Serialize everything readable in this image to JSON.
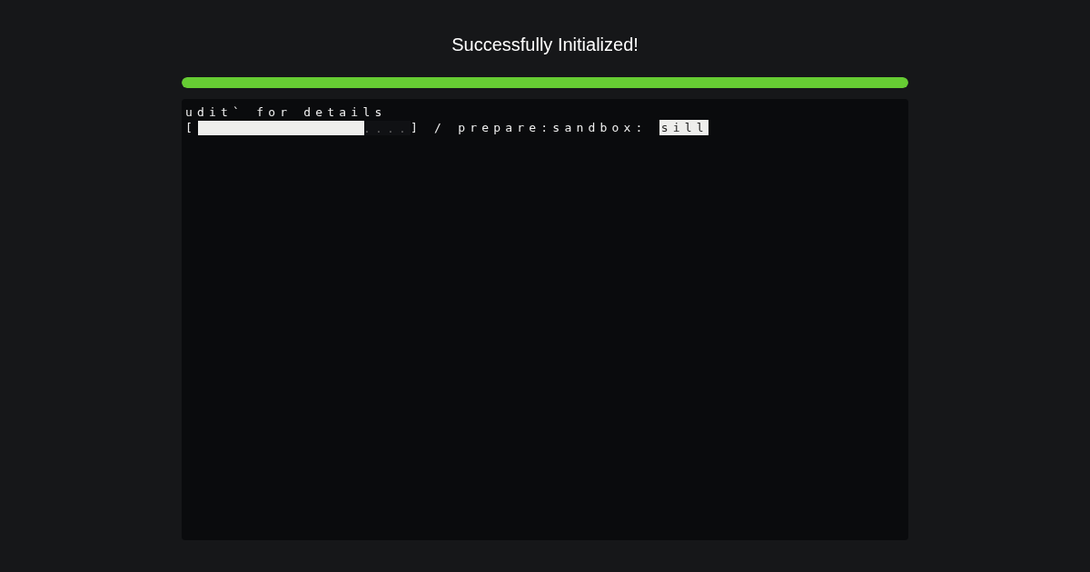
{
  "title": "Successfully Initialized!",
  "progress": {
    "level": 1
  },
  "terminal": {
    "lines": [
      {
        "kind": "text",
        "text": "udit` for details"
      },
      {
        "kind": "progress",
        "open": "[",
        "level": 0.78,
        "dots": "....",
        "close": "]",
        "spinner": "/",
        "task": "prepare:sandbox:",
        "status": "sill"
      }
    ]
  }
}
